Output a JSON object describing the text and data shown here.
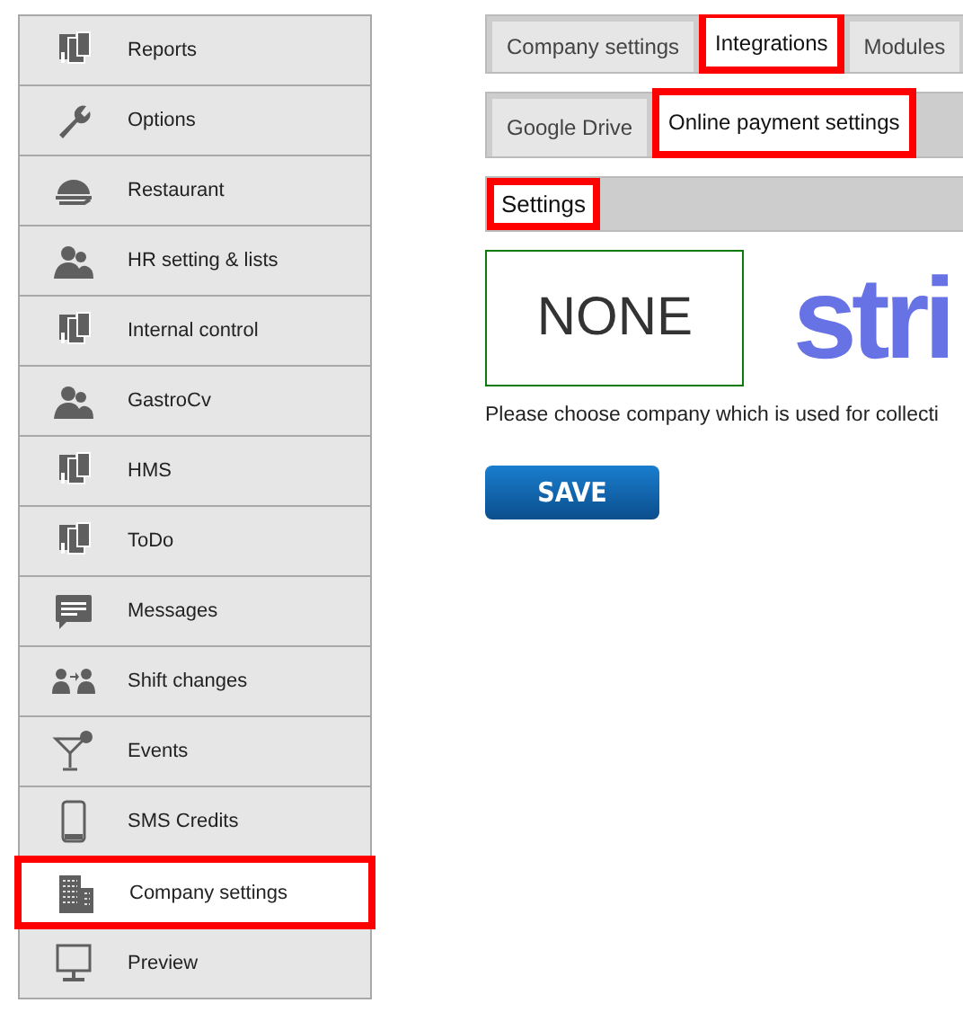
{
  "sidebar": {
    "items": [
      {
        "label": "Reports",
        "selected": false,
        "highlighted": false
      },
      {
        "label": "Options",
        "selected": false,
        "highlighted": false
      },
      {
        "label": "Restaurant",
        "selected": false,
        "highlighted": false
      },
      {
        "label": "HR setting & lists",
        "selected": false,
        "highlighted": false
      },
      {
        "label": "Internal control",
        "selected": false,
        "highlighted": false
      },
      {
        "label": "GastroCv",
        "selected": false,
        "highlighted": false
      },
      {
        "label": "HMS",
        "selected": false,
        "highlighted": false
      },
      {
        "label": "ToDo",
        "selected": false,
        "highlighted": false
      },
      {
        "label": "Messages",
        "selected": false,
        "highlighted": false
      },
      {
        "label": "Shift changes",
        "selected": false,
        "highlighted": false
      },
      {
        "label": "Events",
        "selected": false,
        "highlighted": false
      },
      {
        "label": "SMS Credits",
        "selected": false,
        "highlighted": false
      },
      {
        "label": "Company settings",
        "selected": true,
        "highlighted": true
      },
      {
        "label": "Preview",
        "selected": false,
        "highlighted": false
      }
    ]
  },
  "tabs": [
    {
      "label": "Company settings",
      "selected": false,
      "highlighted": false
    },
    {
      "label": "Integrations",
      "selected": true,
      "highlighted": true
    },
    {
      "label": "Modules",
      "selected": false,
      "highlighted": false
    }
  ],
  "subtabs": [
    {
      "label": "Google Drive",
      "selected": false,
      "highlighted": false
    },
    {
      "label": "Online payment settings",
      "selected": true,
      "highlighted": true
    }
  ],
  "section": {
    "label": "Settings",
    "highlighted": true
  },
  "providers": [
    {
      "label": "NONE",
      "kind": "text",
      "selected": true
    },
    {
      "label": "stri",
      "kind": "logo",
      "selected": false
    }
  ],
  "description": "Please choose company which is used for collecti",
  "save_button": "SAVE"
}
